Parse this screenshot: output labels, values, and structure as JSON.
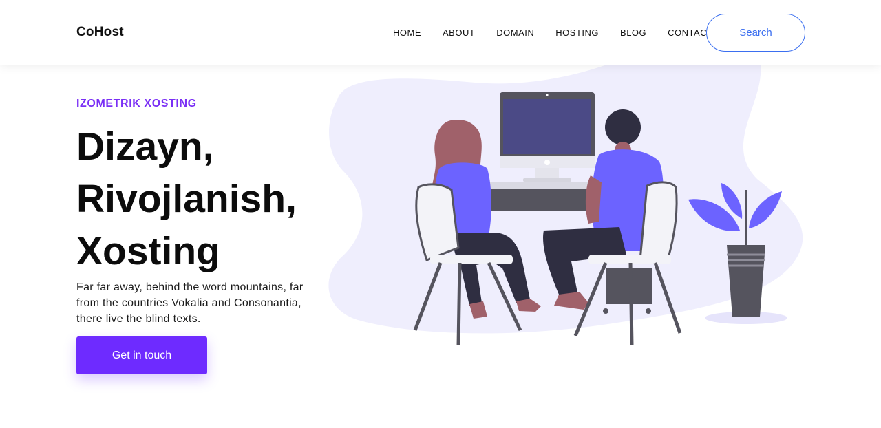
{
  "header": {
    "brand": "CoHost",
    "nav": [
      "HOME",
      "ABOUT",
      "DOMAIN",
      "HOSTING",
      "BLOG",
      "CONTACT"
    ],
    "search_label": "Search"
  },
  "hero": {
    "eyebrow": "IZOMETRIK XOSTING",
    "headline": [
      "Dizayn,",
      "Rivojlanish,",
      "Xosting"
    ],
    "lede": "Far far away, behind the word mountains, far from the countries Vokalia and Consonantia, there live the blind texts.",
    "cta_label": "Get in touch"
  },
  "colors": {
    "accent": "#6e2bff",
    "eyebrow": "#7a2ff5",
    "search_border": "#3b6ff0",
    "blob": "#efeefd",
    "figure_purple": "#6c63ff"
  }
}
